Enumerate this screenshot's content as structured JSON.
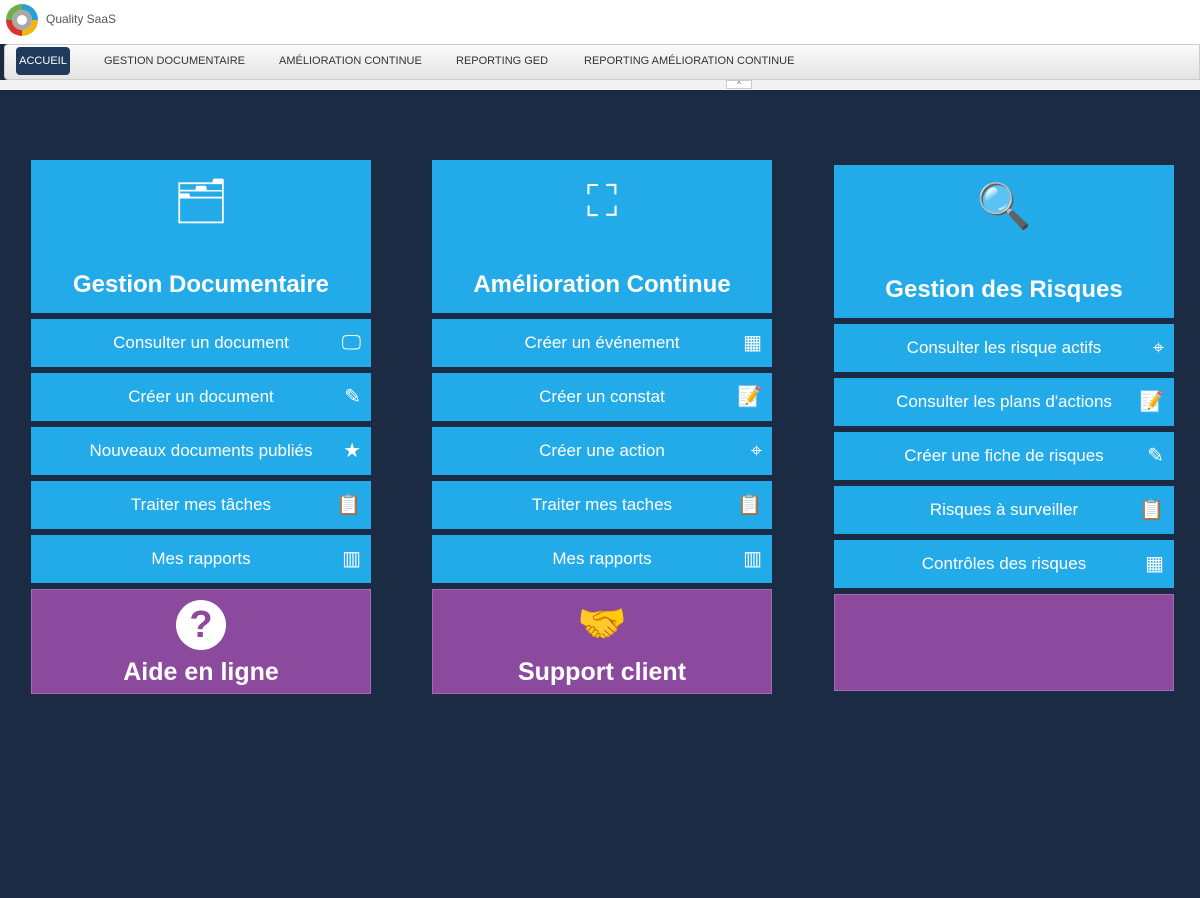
{
  "app": {
    "brand": "Quality SaaS"
  },
  "nav": {
    "items": [
      "ACCUEIL",
      "GESTION DOCUMENTAIRE",
      "AMÉLIORATION CONTINUE",
      "REPORTING GED",
      "REPORTING AMÉLIORATION CONTINUE"
    ],
    "toggle": "^"
  },
  "columns": [
    {
      "title": "Gestion Documentaire",
      "icon": "folder-icon",
      "rows": [
        {
          "label": "Consulter un document",
          "icon": "monitor-plus-icon"
        },
        {
          "label": "Créer un document",
          "icon": "pencil-icon"
        },
        {
          "label": "Nouveaux documents publiés",
          "icon": "star-icon"
        },
        {
          "label": "Traiter mes tâches",
          "icon": "clipboard-icon"
        },
        {
          "label": "Mes rapports",
          "icon": "bar-chart-icon"
        }
      ],
      "footer": "Aide en ligne"
    },
    {
      "title": "Amélioration Continue",
      "icon": "flowchart-icon",
      "rows": [
        {
          "label": "Créer un événement",
          "icon": "calendar-icon"
        },
        {
          "label": "Créer un constat",
          "icon": "note-icon"
        },
        {
          "label": "Créer une action",
          "icon": "target-icon"
        },
        {
          "label": "Traiter mes taches",
          "icon": "clipboard-icon"
        },
        {
          "label": "Mes rapports",
          "icon": "bar-chart-icon"
        }
      ],
      "footer": "Support client"
    },
    {
      "title": "Gestion des Risques",
      "icon": "search-alert-icon",
      "rows": [
        {
          "label": "Consulter les risque actifs",
          "icon": "target-icon"
        },
        {
          "label": "Consulter les plans d'actions",
          "icon": "note-icon"
        },
        {
          "label": "Créer une fiche de risques",
          "icon": "pencil-icon"
        },
        {
          "label": "Risques à surveiller",
          "icon": "clipboard-icon"
        },
        {
          "label": "Contrôles des risques",
          "icon": "calendar-icon"
        }
      ],
      "footer": ""
    }
  ]
}
